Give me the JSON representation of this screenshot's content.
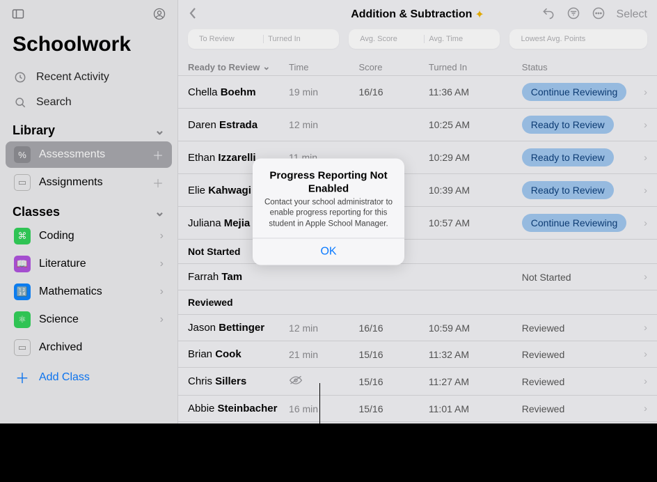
{
  "app": {
    "title": "Schoolwork"
  },
  "sidebar": {
    "recent": "Recent Activity",
    "search": "Search",
    "library_label": "Library",
    "library": [
      {
        "label": "Assessments",
        "selected": true
      },
      {
        "label": "Assignments",
        "selected": false
      }
    ],
    "classes_label": "Classes",
    "classes": [
      {
        "label": "Coding"
      },
      {
        "label": "Literature"
      },
      {
        "label": "Mathematics"
      },
      {
        "label": "Science"
      },
      {
        "label": "Archived"
      }
    ],
    "add_class": "Add Class"
  },
  "header": {
    "title": "Addition & Subtraction",
    "select": "Select"
  },
  "cards": {
    "c1a": "To Review",
    "c1b": "Turned In",
    "c2a": "Avg. Score",
    "c2b": "Avg. Time",
    "c3": "Lowest Avg. Points"
  },
  "columns": {
    "c0": "Ready to Review",
    "c1": "Time",
    "c2": "Score",
    "c3": "Turned In",
    "c4": "Status"
  },
  "sections": {
    "not_started": "Not Started",
    "reviewed": "Reviewed"
  },
  "rows": {
    "ready": [
      {
        "first": "Chella",
        "last": "Boehm",
        "time": "19 min",
        "score": "16/16",
        "turnedin": "11:36 AM",
        "status": "Continue Reviewing",
        "pill": true
      },
      {
        "first": "Daren",
        "last": "Estrada",
        "time": "12 min",
        "score": "",
        "turnedin": "10:25 AM",
        "status": "Ready to Review",
        "pill": true
      },
      {
        "first": "Ethan",
        "last": "Izzarelli",
        "time": "11 min",
        "score": "",
        "turnedin": "10:29 AM",
        "status": "Ready to Review",
        "pill": true
      },
      {
        "first": "Elie",
        "last": "Kahwagi",
        "time": "",
        "score": "",
        "turnedin": "10:39 AM",
        "status": "Ready to Review",
        "pill": true
      },
      {
        "first": "Juliana",
        "last": "Mejia",
        "time": "",
        "score": "",
        "turnedin": "10:57 AM",
        "status": "Continue Reviewing",
        "pill": true
      }
    ],
    "not_started": [
      {
        "first": "Farrah",
        "last": "Tam",
        "time": "",
        "score": "",
        "turnedin": "",
        "status": "Not Started",
        "pill": false
      }
    ],
    "reviewed": [
      {
        "first": "Jason",
        "last": "Bettinger",
        "time": "12 min",
        "score": "16/16",
        "turnedin": "10:59 AM",
        "status": "Reviewed",
        "pill": false
      },
      {
        "first": "Brian",
        "last": "Cook",
        "time": "21 min",
        "score": "15/16",
        "turnedin": "11:32 AM",
        "status": "Reviewed",
        "pill": false
      },
      {
        "first": "Chris",
        "last": "Sillers",
        "time": "",
        "eye": true,
        "score": "15/16",
        "turnedin": "11:27 AM",
        "status": "Reviewed",
        "pill": false
      },
      {
        "first": "Abbie",
        "last": "Steinbacher",
        "time": "16 min",
        "score": "15/16",
        "turnedin": "11:01 AM",
        "status": "Reviewed",
        "pill": false
      }
    ]
  },
  "modal": {
    "title": "Progress Reporting Not Enabled",
    "message": "Contact your school administrator to enable progress reporting for this student in Apple School Manager.",
    "ok": "OK"
  }
}
